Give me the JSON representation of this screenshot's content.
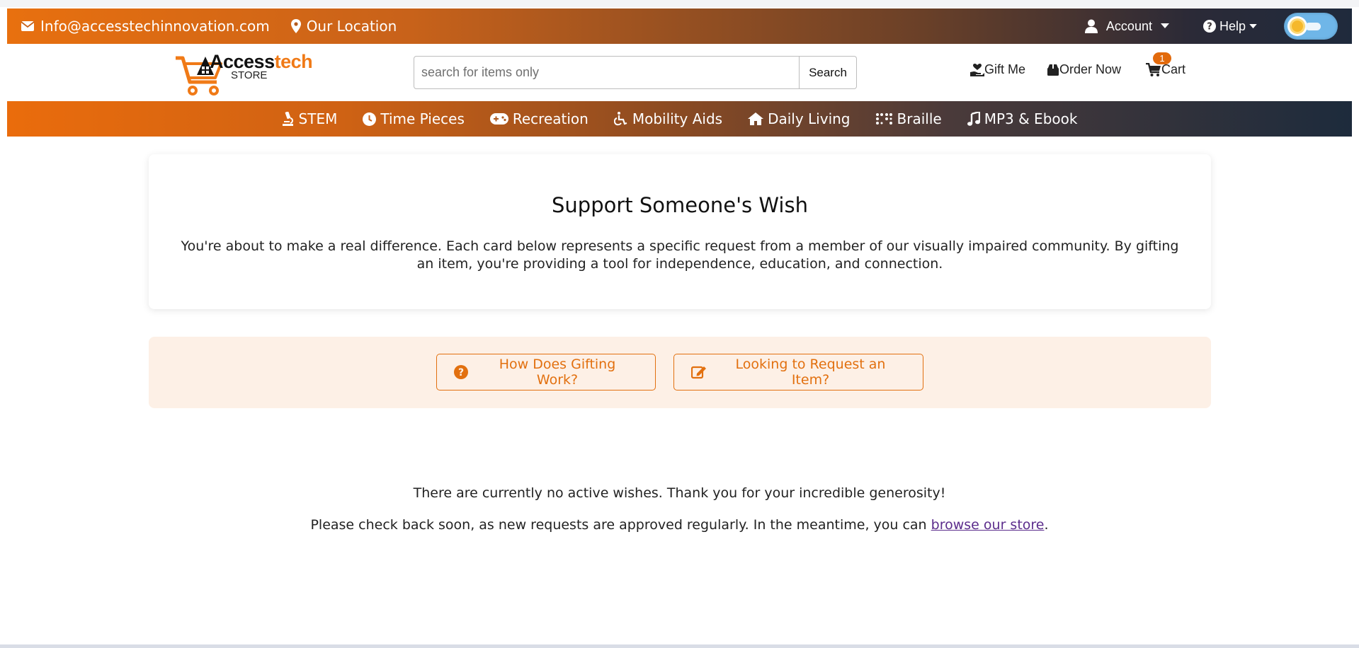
{
  "topbar": {
    "email": "Info@accesstechinnovation.com",
    "location": "Our Location",
    "account": "Account",
    "help": "Help",
    "theme_toggle_state": "light"
  },
  "header": {
    "logo_access": "Access",
    "logo_tech": "tech",
    "logo_store": "STORE",
    "search_placeholder": "search for items only",
    "search_button": "Search",
    "gift_me": "Gift Me",
    "order_now": "Order Now",
    "cart": "Cart",
    "cart_count": "1"
  },
  "categories": [
    {
      "label": "STEM",
      "icon": "microscope-icon"
    },
    {
      "label": "Time Pieces",
      "icon": "clock-icon"
    },
    {
      "label": "Recreation",
      "icon": "gamepad-icon"
    },
    {
      "label": "Mobility Aids",
      "icon": "wheelchair-icon"
    },
    {
      "label": "Daily Living",
      "icon": "home-icon"
    },
    {
      "label": "Braille",
      "icon": "braille-icon"
    },
    {
      "label": "MP3 & Ebook",
      "icon": "music-icon"
    }
  ],
  "intro": {
    "title": "Support Someone's Wish",
    "text": "You're about to make a real difference. Each card below represents a specific request from a member of our visually impaired community. By gifting an item, you're providing a tool for independence, education, and connection."
  },
  "actions": {
    "how_gifting": "How Does Gifting Work?",
    "request_item": "Looking to Request an Item?"
  },
  "empty_state": {
    "line1": "There are currently no active wishes. Thank you for your incredible generosity!",
    "line2_prefix": "Please check back soon, as new requests are approved regularly. In the meantime, you can ",
    "link": "browse our store",
    "line2_suffix": "."
  },
  "colors": {
    "accent": "#e2700f",
    "nav_dark": "#1d2b3c",
    "link": "#5b2c8c"
  }
}
